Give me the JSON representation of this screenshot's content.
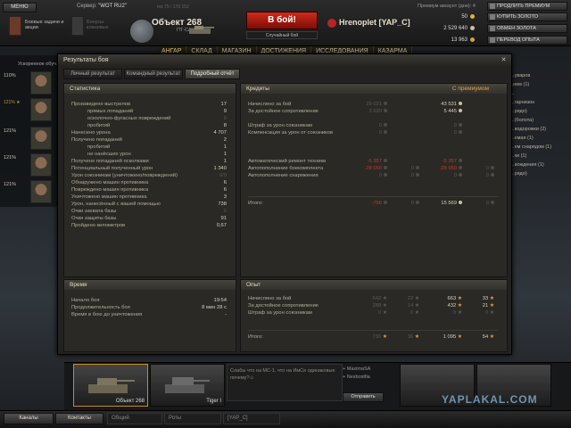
{
  "topbar": {
    "menu_label": "МЕНЮ",
    "server_label": "Сервер:",
    "server_name": "\"WOT RU2\"",
    "ping": "ms 75  /  170 152",
    "missions_label": "Боевые задачи и акции",
    "bonus_label": "Бонусы клановых",
    "tank_name": "Объект 268",
    "tank_type": "ПТ-САУ",
    "battle_button": "В бой!",
    "battle_mode": "Случайный бой",
    "player": "Hrenoplet [YAP_C]",
    "premium_label": "Премиум аккаунт (дни): 4",
    "gold": "50",
    "credits": "2 529 640",
    "free_xp": "13 963",
    "buttons": [
      "ПРОДЛИТЬ ПРЕМИУМ",
      "КУПИТЬ ЗОЛОТО",
      "ОБМЕН ЗОЛОТА",
      "ПЕРЕВОД ОПЫТА"
    ]
  },
  "nav": [
    "АНГАР",
    "СКЛАД",
    "МАГАЗИН",
    "ДОСТИЖЕНИЯ",
    "ИССЛЕДОВАНИЯ",
    "КАЗАРМА"
  ],
  "left": {
    "label": "Ускоренное обуч...",
    "crew": [
      {
        "pct": "110%",
        "tag": ""
      },
      {
        "pct": "121%",
        "tag": "121% ★"
      },
      {
        "pct": "121%",
        "tag": ""
      },
      {
        "pct": "121%",
        "tag": ""
      },
      {
        "pct": "121%",
        "tag": ""
      }
    ]
  },
  "right_list": [
    "...уваров",
    "..ием (1)",
    "...",
    "...гарнизон",
    "...рядо)",
    "...(болота)",
    "...водорожки (2)",
    "...емая (1)",
    "...ем снарядом (1)",
    "...ки (1)",
    "...вождения (1)",
    "...рядо)"
  ],
  "window": {
    "title": "Результаты боя",
    "tabs": [
      "Личный результат",
      "Командный результат",
      "Подробный отчёт"
    ],
    "stats": {
      "header": "Статистика",
      "rows": [
        {
          "k": "Произведено выстрелов",
          "v": "17",
          "indent": false,
          "dim": false
        },
        {
          "k": "прямых попаданий",
          "v": "9",
          "indent": true,
          "dim": false
        },
        {
          "k": "осколочно-фугасных повреждений",
          "v": "0",
          "indent": true,
          "dim": true
        },
        {
          "k": "пробитий",
          "v": "8",
          "indent": true,
          "dim": false
        },
        {
          "k": "Нанесено урона",
          "v": "4 707",
          "indent": false,
          "dim": false
        },
        {
          "k": "Получено попаданий",
          "v": "2",
          "indent": false,
          "dim": false
        },
        {
          "k": "пробитий",
          "v": "1",
          "indent": true,
          "dim": false
        },
        {
          "k": "не нанёсших урон",
          "v": "1",
          "indent": true,
          "dim": false
        },
        {
          "k": "Получено попаданий осколками",
          "v": "1",
          "indent": false,
          "dim": false
        },
        {
          "k": "Потенциальный полученный урон",
          "v": "1 340",
          "indent": false,
          "dim": false
        },
        {
          "k": "Урон союзникам (уничтожено/повреждений)",
          "v": "0/0",
          "indent": false,
          "dim": true
        },
        {
          "k": "Обнаружено машин противника",
          "v": "6",
          "indent": false,
          "dim": false
        },
        {
          "k": "Повреждено машин противника",
          "v": "6",
          "indent": false,
          "dim": false
        },
        {
          "k": "Уничтожено машин противника",
          "v": "3",
          "indent": false,
          "dim": false
        },
        {
          "k": "Урон, нанесённый с вашей помощью",
          "v": "738",
          "indent": false,
          "dim": false
        },
        {
          "k": "Очки захвата базы",
          "v": "0",
          "indent": false,
          "dim": true
        },
        {
          "k": "Очки защиты базы",
          "v": "91",
          "indent": false,
          "dim": false
        },
        {
          "k": "Пройдено километров",
          "v": "0,67",
          "indent": false,
          "dim": false
        }
      ]
    },
    "credits": {
      "header": "Кредиты",
      "premium": "С премиумом",
      "rows": [
        {
          "k": "Начислено за бой",
          "a": "29 021",
          "b": "",
          "c": "43 531",
          "d": ""
        },
        {
          "k": "За достойное сопротивление",
          "a": "3 630",
          "b": "",
          "c": "5 445",
          "d": ""
        },
        {
          "k": "",
          "a": "",
          "b": "",
          "c": "",
          "d": ""
        },
        {
          "k": "Штраф за урон союзникам",
          "a": "0",
          "b": "",
          "c": "0",
          "d": ""
        },
        {
          "k": "Компенсация за урон от союзников",
          "a": "0",
          "b": "",
          "c": "0",
          "d": ""
        },
        {
          "k": "",
          "a": "",
          "b": "",
          "c": "",
          "d": ""
        },
        {
          "k": "",
          "a": "",
          "b": "",
          "c": "",
          "d": ""
        },
        {
          "k": "",
          "a": "",
          "b": "",
          "c": "",
          "d": ""
        },
        {
          "k": "Автоматический ремонт техники",
          "a": "-5 357",
          "b": "",
          "c": "-5 357",
          "d": ""
        },
        {
          "k": "Автопополнение боекомплекта",
          "a": "-28 050",
          "b": "0",
          "c": "-28 050",
          "d": "0"
        },
        {
          "k": "Автопополнение снаряжения",
          "a": "0",
          "b": "0",
          "c": "0",
          "d": "0"
        }
      ],
      "total_label": "Итого:",
      "total_a": "-756",
      "total_c": "15 569",
      "total_b": "0",
      "total_d": "0"
    },
    "time": {
      "header": "Время",
      "rows": [
        {
          "k": "Начало боя",
          "v": "19:54"
        },
        {
          "k": "Продолжительность боя",
          "v": "8 мин 28 с"
        },
        {
          "k": "Время в бою до уничтожения",
          "v": "-"
        }
      ]
    },
    "xp": {
      "header": "Опыт",
      "rows": [
        {
          "k": "Начислено за бой",
          "a": "642",
          "b": "22",
          "c": "663",
          "d": "33"
        },
        {
          "k": "За достойное сопротивление",
          "a": "288",
          "b": "14",
          "c": "432",
          "d": "21"
        },
        {
          "k": "Штраф за урон союзникам",
          "a": "0",
          "b": "0",
          "c": "0",
          "d": "0"
        }
      ],
      "total_label": "Итого:",
      "total_a": "730",
      "total_b": "36",
      "total_c": "1 095",
      "total_d": "54"
    }
  },
  "carousel": {
    "tanks": [
      "Объект 268",
      "Tiger I"
    ],
    "chat_text": "Слабы что на МС-1, что на ИмСе одинаковые почему?☺",
    "players": [
      "+ MaximaSA",
      "+ Nexbostfia"
    ],
    "send": "Отправить"
  },
  "bottombar": {
    "channels": "Каналы",
    "contacts": "Контакты",
    "tabs": [
      "Общий",
      "Роты",
      "[YAP_C]"
    ]
  },
  "watermark": "YAPLAKAL.COM",
  "colors": {
    "accent": "#e6a23a",
    "battle": "#c42a1a",
    "negative": "#c43a2a"
  }
}
